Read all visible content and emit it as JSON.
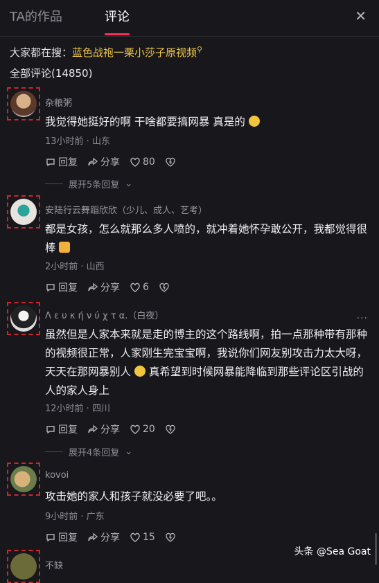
{
  "tabs": {
    "works": "TA的作品",
    "comments": "评论"
  },
  "close_glyph": "✕",
  "search": {
    "label": "大家都在搜：",
    "term": "蓝色战袍一栗小莎子原视频",
    "icon": "search-icon"
  },
  "comment_count": "全部评论(14850)",
  "actions": {
    "reply": "回复",
    "share": "分享"
  },
  "comments": [
    {
      "name": "杂粮粥",
      "text": "我觉得她挺好的啊  干啥都要搞网暴  真是的",
      "meta": "13小时前 · 山东",
      "likes": "80",
      "expand": "展开5条回复"
    },
    {
      "name": "安陆行云舞蹈欣欣（少儿、成人、艺考）",
      "text": "都是女孩，怎么就那么多人喷的，就冲着她怀孕敢公开，我都觉得很棒",
      "meta": "2小时前 · 山西",
      "likes": "6"
    },
    {
      "name": "Λ ε υ κ ή  ν ύ χ τ α.（白夜）",
      "text": "虽然但是人家本来就是走的博主的这个路线啊，拍一点那种带有那种的视频很正常，人家刚生完宝宝啊，我说你们网友别攻击力太大呀，天天在那网暴别人",
      "text2": "真希望到时候网暴能降临到那些评论区引战的人的家人身上",
      "meta": "12小时前 · 四川",
      "likes": "20",
      "expand": "展开4条回复"
    },
    {
      "name": "kovoi",
      "text": "攻击她的家人和孩子就没必要了吧。。",
      "meta": "9小时前 · 广东",
      "likes": "15"
    },
    {
      "name": "不缺"
    }
  ],
  "watermark": "头条 @Sea Goat",
  "colors": {
    "accent": "#fe2c55",
    "search_term": "#f0c747",
    "background": "#17171c"
  }
}
